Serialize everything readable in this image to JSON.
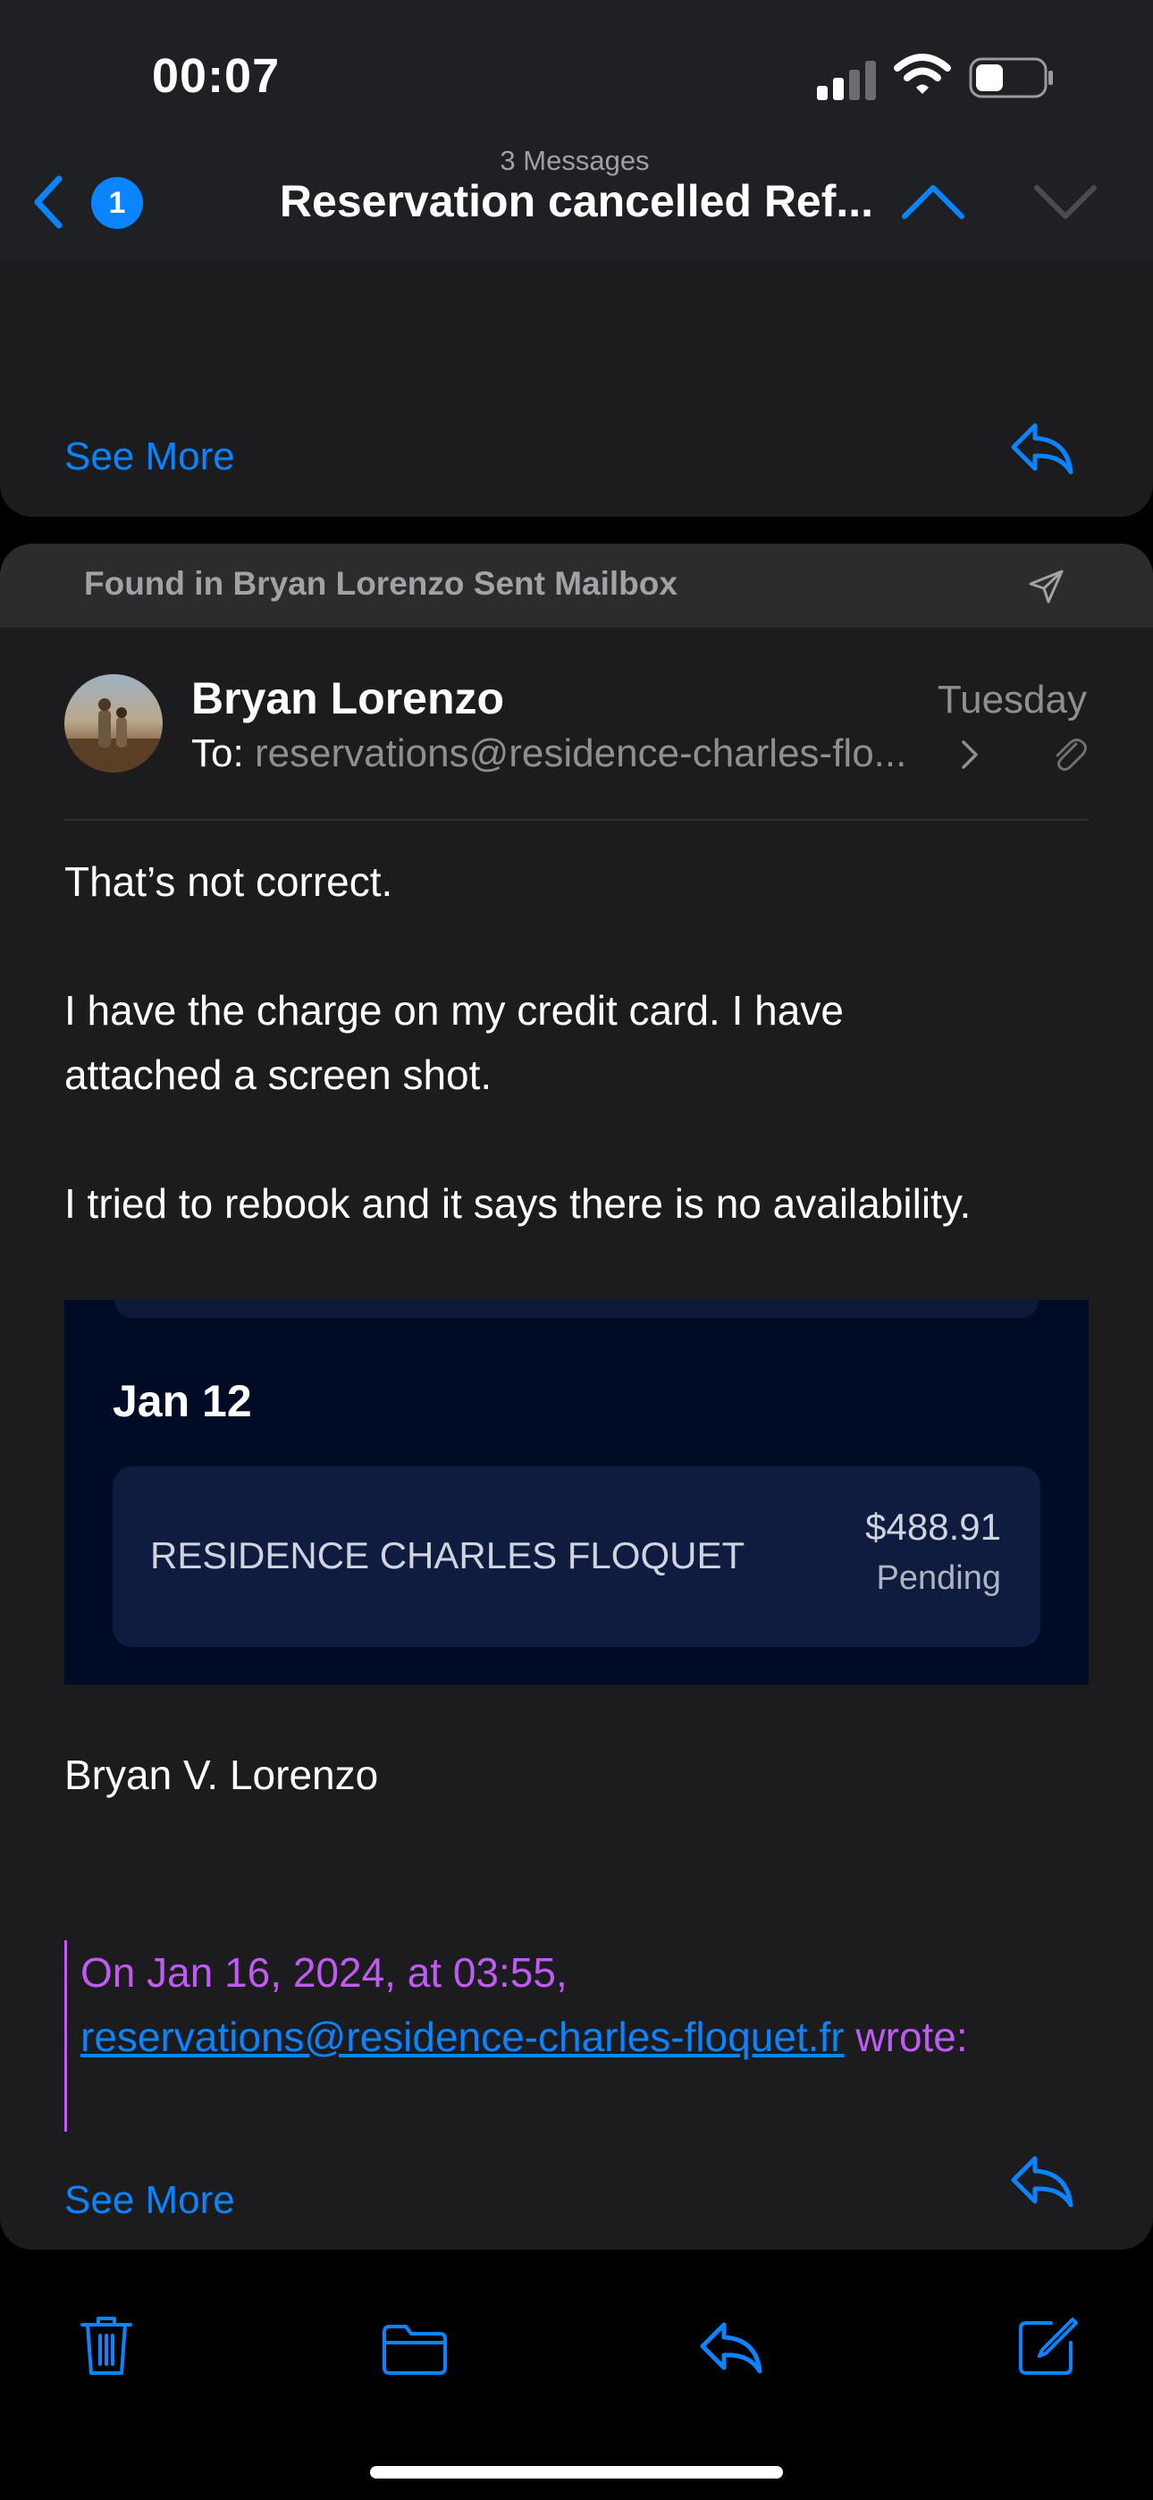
{
  "status_bar": {
    "time": "00:07"
  },
  "nav": {
    "back_badge": "1",
    "message_count": "3 Messages",
    "title": "Reservation cancelled Ref..."
  },
  "message1": {
    "see_more": "See More"
  },
  "message2": {
    "found_in": "Found in Bryan Lorenzo Sent Mailbox",
    "sender": "Bryan Lorenzo",
    "date": "Tuesday",
    "to_label": "To:",
    "to_address": "reservations@residence-charles-flo...",
    "body": [
      "That’s not correct.",
      "I have the charge on my credit card. I have",
      "attached a screen shot.",
      "I tried to rebook and it says there is no availability."
    ],
    "attachment": {
      "date": "Jan 12",
      "merchant": "RESIDENCE CHARLES FLOQUET",
      "amount": "$488.91",
      "status": "Pending"
    },
    "signature": "Bryan V. Lorenzo",
    "quote_header": "On Jan 16, 2024, at 03:55,",
    "quote_email": "reservations@residence-charles-floquet.fr",
    "quote_wrote": " wrote:",
    "see_more": "See More"
  },
  "toolbar": {
    "items": [
      "trash-icon",
      "folder-icon",
      "reply-icon",
      "compose-icon"
    ]
  },
  "colors": {
    "accent": "#0a84ff",
    "quote": "#bf5af2",
    "card": "#1c1c1e"
  }
}
